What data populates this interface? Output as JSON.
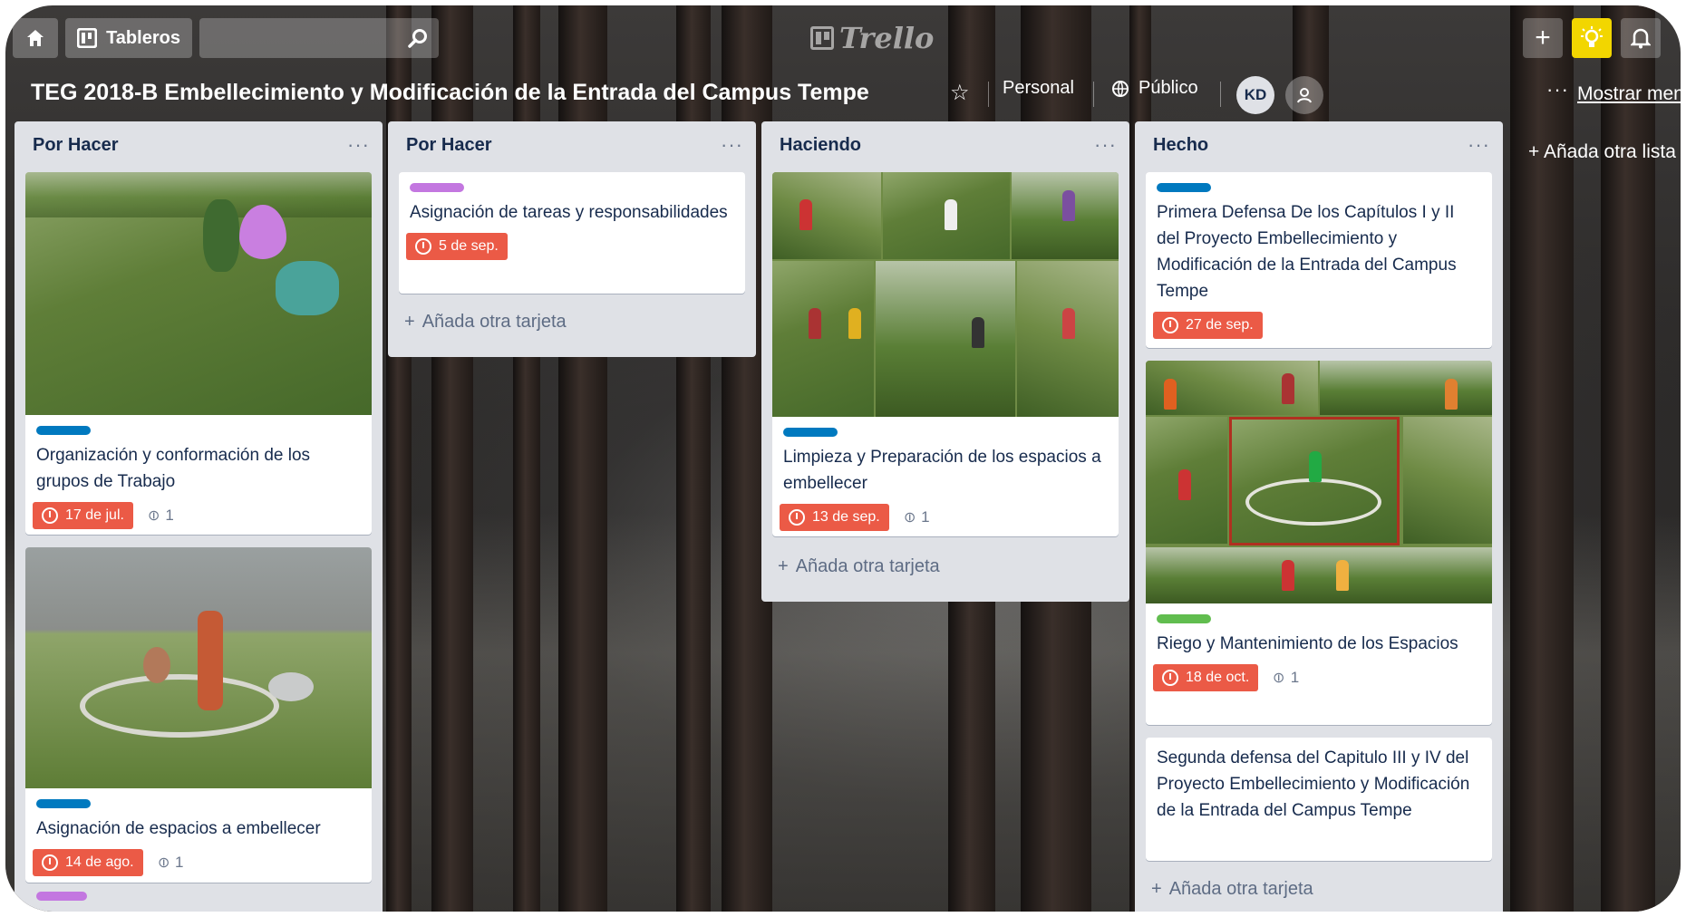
{
  "header": {
    "boards_label": "Tableros",
    "logo_text": "Trello",
    "board_title": "TEG 2018-B Embellecimiento y Modificación de la Entrada del Campus Tempe",
    "team_label": "Personal",
    "visibility_label": "Público",
    "avatar_initials": "KD",
    "show_menu_label": "Mostrar menú",
    "accent_colors": {
      "bulb": "#f2d600",
      "due": "#eb5a46"
    }
  },
  "lists": [
    {
      "title": "Por Hacer",
      "cards": [
        {
          "label_color": "#0079bf",
          "text": "Organización y conformación de los grupos de Trabajo",
          "due": "17 de jul.",
          "attachments": "1"
        },
        {
          "label_color": "#0079bf",
          "text": "Asignación de espacios a embellecer",
          "due": "14 de ago.",
          "attachments": "1"
        }
      ]
    },
    {
      "title": "Por Hacer",
      "cards": [
        {
          "label_color": "#c377e0",
          "text": "Asignación de tareas y responsabilidades",
          "due": "5 de sep."
        }
      ],
      "add_card": "Añada otra tarjeta"
    },
    {
      "title": "Haciendo",
      "cards": [
        {
          "label_color": "#0079bf",
          "text": "Limpieza y Preparación de los espacios a embellecer",
          "due": "13 de sep.",
          "attachments": "1"
        }
      ],
      "add_card": "Añada otra tarjeta"
    },
    {
      "title": "Hecho",
      "cards": [
        {
          "label_color": "#0079bf",
          "text": "Primera Defensa De los Capítulos I y II del Proyecto Embellecimiento y Modificación de la Entrada del Campus Tempe",
          "due": "27 de sep."
        },
        {
          "label_color": "#61bd4f",
          "text": "Riego y Mantenimiento de los Espacios",
          "due": "18 de oct.",
          "attachments": "1"
        },
        {
          "text": "Segunda defensa del Capitulo III y IV del Proyecto Embellecimiento y Modificación de la Entrada del Campus Tempe"
        }
      ],
      "add_card": "Añada otra tarjeta"
    }
  ],
  "add_list_label": "Añada otra lista"
}
